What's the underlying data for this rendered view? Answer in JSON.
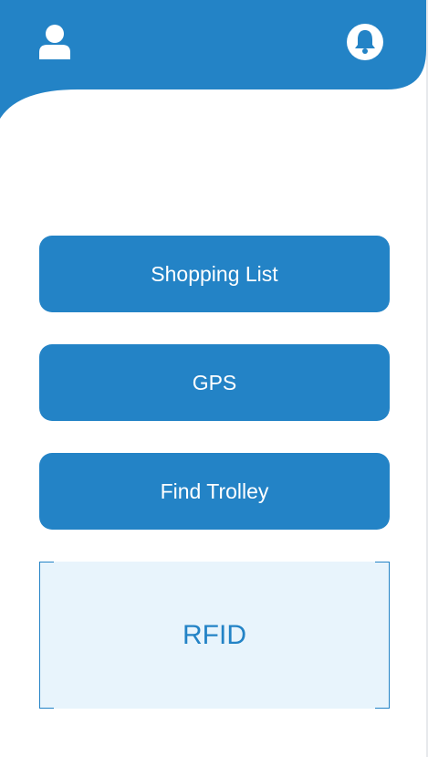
{
  "header": {
    "user_icon": "user-icon",
    "bell_icon": "bell-icon"
  },
  "menu": {
    "shopping_list": "Shopping List",
    "gps": "GPS",
    "find_trolley": "Find Trolley"
  },
  "rfid": {
    "label": "RFID"
  },
  "colors": {
    "primary": "#2383c6",
    "rfid_background": "#e8f4fc",
    "white": "#ffffff"
  }
}
